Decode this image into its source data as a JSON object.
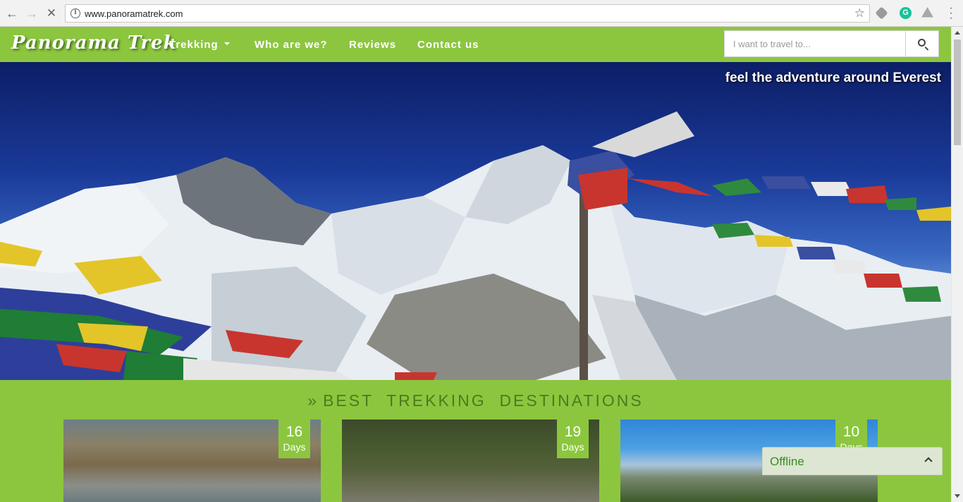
{
  "browser": {
    "url": "www.panoramatrek.com",
    "info_glyph": "i",
    "icons": [
      "back-arrow-icon",
      "forward-arrow-icon",
      "reload-icon",
      "info-icon",
      "bookmark-star-icon",
      "extension-icon",
      "grammarly-icon",
      "drive-icon",
      "menu-icon"
    ],
    "grammarly_glyph": "G"
  },
  "site": {
    "logo": "Panorama Trek",
    "nav": {
      "trekking": "Trekking",
      "who": "Who are we?",
      "reviews": "Reviews",
      "contact": "Contact us"
    },
    "search": {
      "placeholder": "I want to travel to..."
    },
    "accent_color": "#8cc63f"
  },
  "hero": {
    "tagline": "feel the adventure around Everest"
  },
  "destinations": {
    "title": "BEST  TREKKING  DESTINATIONS",
    "raquo": "»",
    "cards": [
      {
        "days": "16",
        "unit": "Days"
      },
      {
        "days": "19",
        "unit": "Days"
      },
      {
        "days": "10",
        "unit": "Days"
      }
    ]
  },
  "chat": {
    "status": "Offline"
  }
}
